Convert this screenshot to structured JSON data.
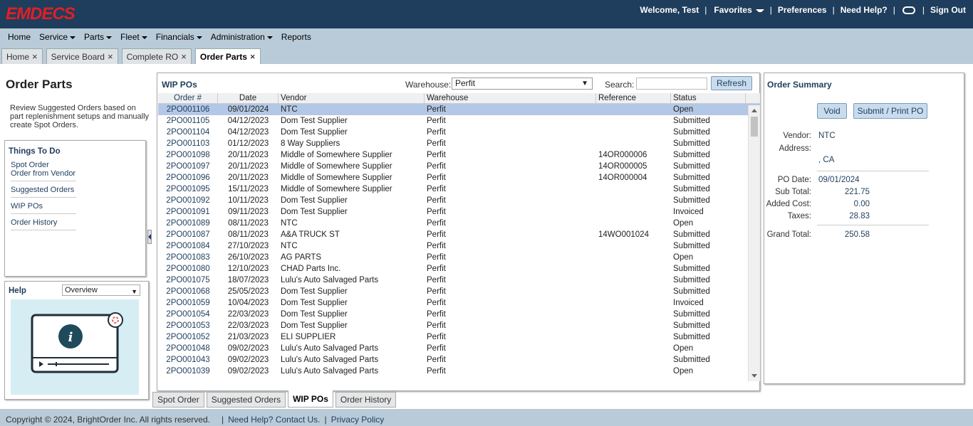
{
  "header": {
    "logo": "EMDECS",
    "welcome": "Welcome, Test",
    "favorites": "Favorites",
    "preferences": "Preferences",
    "need_help": "Need Help?",
    "sign_out": "Sign Out"
  },
  "menu": [
    {
      "label": "Home",
      "dropdown": false
    },
    {
      "label": "Service",
      "dropdown": true
    },
    {
      "label": "Parts",
      "dropdown": true
    },
    {
      "label": "Fleet",
      "dropdown": true
    },
    {
      "label": "Financials",
      "dropdown": true
    },
    {
      "label": "Administration",
      "dropdown": true
    },
    {
      "label": "Reports",
      "dropdown": false
    }
  ],
  "tabs": [
    {
      "label": "Home",
      "active": false
    },
    {
      "label": "Service Board",
      "active": false
    },
    {
      "label": "Complete RO",
      "active": false
    },
    {
      "label": "Order Parts",
      "active": true
    }
  ],
  "left": {
    "title": "Order Parts",
    "description": "Review Suggested Orders based on part replenishment setups and manually create Spot Orders.",
    "todo_title": "Things To Do",
    "todo_links": [
      "Spot Order",
      "Order from Vendor",
      "Suggested Orders",
      "WIP POs",
      "Order History"
    ],
    "help_title": "Help",
    "help_select": "Overview"
  },
  "wip": {
    "title": "WIP POs",
    "warehouse_label": "Warehouse:",
    "warehouse_value": "Perfit",
    "search_label": "Search:",
    "search_value": "",
    "refresh": "Refresh",
    "columns": [
      "Order #",
      "Date",
      "Vendor",
      "Warehouse",
      "Reference",
      "Status"
    ],
    "rows": [
      [
        "2PO001106",
        "09/01/2024",
        "NTC",
        "Perfit",
        "",
        "Open"
      ],
      [
        "2PO001105",
        "04/12/2023",
        "Dom Test Supplier",
        "Perfit",
        "",
        "Submitted"
      ],
      [
        "2PO001104",
        "04/12/2023",
        "Dom Test Supplier",
        "Perfit",
        "",
        "Submitted"
      ],
      [
        "2PO001103",
        "01/12/2023",
        "8 Way Suppliers",
        "Perfit",
        "",
        "Submitted"
      ],
      [
        "2PO001098",
        "20/11/2023",
        "Middle of Somewhere Supplier",
        "Perfit",
        "14OR000006",
        "Submitted"
      ],
      [
        "2PO001097",
        "20/11/2023",
        "Middle of Somewhere Supplier",
        "Perfit",
        "14OR000005",
        "Submitted"
      ],
      [
        "2PO001096",
        "20/11/2023",
        "Middle of Somewhere Supplier",
        "Perfit",
        "14OR000004",
        "Submitted"
      ],
      [
        "2PO001095",
        "15/11/2023",
        "Middle of Somewhere Supplier",
        "Perfit",
        "",
        "Submitted"
      ],
      [
        "2PO001092",
        "10/11/2023",
        "Dom Test Supplier",
        "Perfit",
        "",
        "Submitted"
      ],
      [
        "2PO001091",
        "09/11/2023",
        "Dom Test Supplier",
        "Perfit",
        "",
        "Invoiced"
      ],
      [
        "2PO001089",
        "08/11/2023",
        "NTC",
        "Perfit",
        "",
        "Open"
      ],
      [
        "2PO001087",
        "08/11/2023",
        "A&A TRUCK ST",
        "Perfit",
        "14WO001024",
        "Submitted"
      ],
      [
        "2PO001084",
        "27/10/2023",
        "NTC",
        "Perfit",
        "",
        "Submitted"
      ],
      [
        "2PO001083",
        "26/10/2023",
        "AG PARTS",
        "Perfit",
        "",
        "Open"
      ],
      [
        "2PO001080",
        "12/10/2023",
        "CHAD Parts Inc.",
        "Perfit",
        "",
        "Submitted"
      ],
      [
        "2PO001075",
        "18/07/2023",
        "Lulu's Auto Salvaged Parts",
        "Perfit",
        "",
        "Submitted"
      ],
      [
        "2PO001068",
        "25/05/2023",
        "Dom Test Supplier",
        "Perfit",
        "",
        "Submitted"
      ],
      [
        "2PO001059",
        "10/04/2023",
        "Dom Test Supplier",
        "Perfit",
        "",
        "Invoiced"
      ],
      [
        "2PO001054",
        "22/03/2023",
        "Dom Test Supplier",
        "Perfit",
        "",
        "Submitted"
      ],
      [
        "2PO001053",
        "22/03/2023",
        "Dom Test Supplier",
        "Perfit",
        "",
        "Submitted"
      ],
      [
        "2PO001052",
        "21/03/2023",
        "ELI SUPPLIER",
        "Perfit",
        "",
        "Submitted"
      ],
      [
        "2PO001048",
        "09/02/2023",
        "Lulu's Auto Salvaged Parts",
        "Perfit",
        "",
        "Open"
      ],
      [
        "2PO001043",
        "09/02/2023",
        "Lulu's Auto Salvaged Parts",
        "Perfit",
        "",
        "Submitted"
      ],
      [
        "2PO001039",
        "09/02/2023",
        "Lulu's Auto Salvaged Parts",
        "Perfit",
        "",
        "Open"
      ]
    ],
    "selected_row": 0
  },
  "subtabs": [
    {
      "label": "Spot Order",
      "active": false
    },
    {
      "label": "Suggested Orders",
      "active": false
    },
    {
      "label": "WIP POs",
      "active": true
    },
    {
      "label": "Order History",
      "active": false
    }
  ],
  "summary": {
    "title": "Order Summary",
    "void": "Void",
    "submit_print": "Submit / Print PO",
    "vendor_label": "Vendor:",
    "vendor": "NTC",
    "address_label": "Address:",
    "address": ", CA",
    "po_date_label": "PO Date:",
    "po_date": "09/01/2024",
    "subtotal_label": "Sub Total:",
    "subtotal": "221.75",
    "added_cost_label": "Added Cost:",
    "added_cost": "0.00",
    "taxes_label": "Taxes:",
    "taxes": "28.83",
    "grand_total_label": "Grand Total:",
    "grand_total": "250.58"
  },
  "footer": {
    "copyright": "Copyright © 2024, BrightOrder Inc. All rights reserved.",
    "help_link": "Need Help? Contact Us.",
    "privacy": "Privacy Policy"
  }
}
